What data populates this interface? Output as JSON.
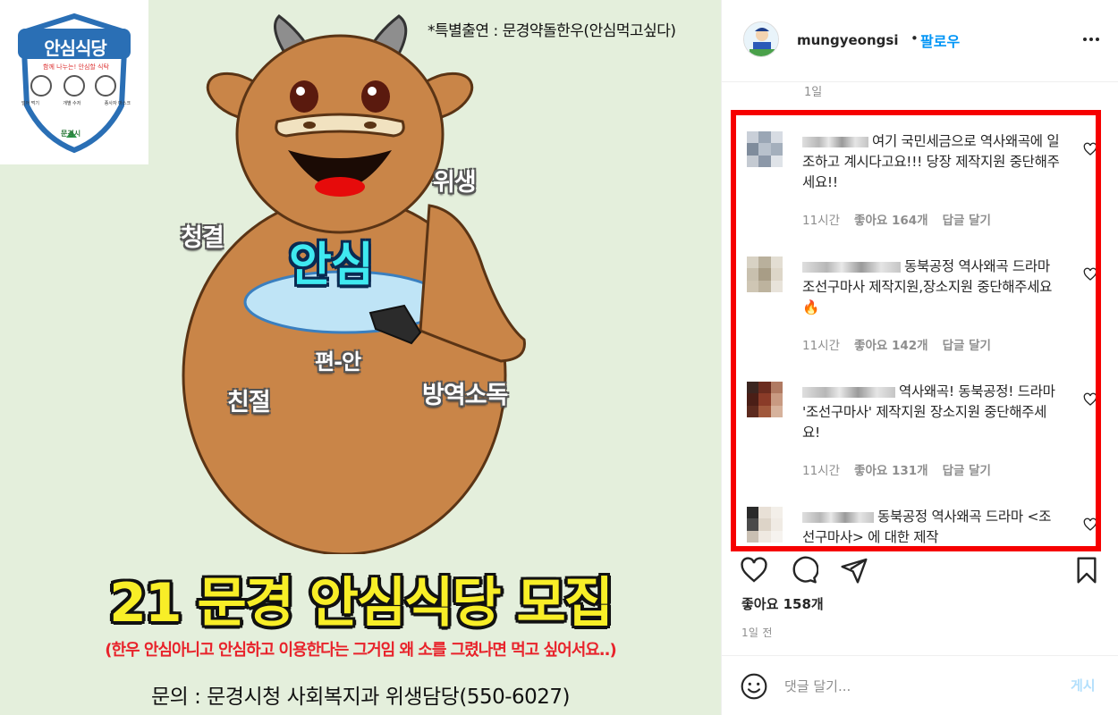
{
  "poster": {
    "logo": {
      "title": "안심식당",
      "tagline": "함께 나누는! 안심할 식탁",
      "items": [
        "덜어 먹기",
        "개별 수저",
        "종사자 마스크"
      ],
      "org": "문경시"
    },
    "special_guest": "*특별출연 : 문경약돌한우(안심먹고싶다)",
    "labels": {
      "center": "안심",
      "hygiene": "위생",
      "clean": "청결",
      "comfort": "편-안",
      "kind": "친절",
      "disinfect": "방역소독"
    },
    "headline": "21 문경 안심식당 모집",
    "subline": "(한우 안심아니고 안심하고 이용한다는 그거임 왜 소를 그렸나면 먹고 싶어서요..)",
    "contact": "문의 : 문경시청 사회복지과 위생담당(550-6027)"
  },
  "post": {
    "username": "mungyeongsi",
    "follow_dot": "•",
    "follow_label": "팔로우",
    "more_icon": "more-horizontal-icon",
    "prev_comment_time": "1일",
    "comments": [
      {
        "text": "여기 국민세금으로 역사왜곡에 일조하고 계시다고요!!! 당장 제작지원 중단해주세요!!",
        "time": "11시간",
        "likes": "좋아요 164개",
        "reply": "답글 달기",
        "avatar_colors": [
          "#c9cfd8",
          "#9aa6b5",
          "#d7dce3",
          "#7f8c9c",
          "#b8c1cc",
          "#a4afbc",
          "#c4cad2",
          "#8c98a8",
          "#dfe3e8"
        ]
      },
      {
        "text": "동북공정 역사왜곡 드라마 조선구마사 제작지원,장소지원 중단해주세요🔥",
        "time": "11시간",
        "likes": "좋아요 142개",
        "reply": "답글 달기",
        "avatar_colors": [
          "#d8d2c4",
          "#b9b09c",
          "#e3ded3",
          "#c8c0ae",
          "#a89d86",
          "#ddd6c8",
          "#cfc6b4",
          "#bdb39e",
          "#e8e3da"
        ]
      },
      {
        "text": "역사왜곡! 동북공정! 드라마 '조선구마사' 제작지원 장소지원 중단해주세요!",
        "time": "11시간",
        "likes": "좋아요 131개",
        "reply": "답글 달기",
        "avatar_colors": [
          "#3b2520",
          "#6b2c1f",
          "#b07a62",
          "#4a1e16",
          "#8a3b28",
          "#c89a82",
          "#5c2a1e",
          "#a0583c",
          "#d6b29c"
        ]
      },
      {
        "text": "동북공정 역사왜곡 드라마 <조선구마사> 에 대한 제작",
        "time": "",
        "likes": "",
        "reply": "",
        "avatar_colors": [
          "#2a2a2a",
          "#e8e0d6",
          "#f3efe9",
          "#4a4a4a",
          "#ddd4c8",
          "#f0ebe4",
          "#c9bfb2",
          "#efe9e1",
          "#f6f3ef"
        ]
      }
    ],
    "likes_total": "좋아요 158개",
    "post_time": "1일 전",
    "comment_placeholder": "댓글 달기...",
    "post_button": "게시",
    "colors": {
      "accent": "#0095f6",
      "highlight_frame": "#f60000",
      "headline_yellow": "#f8ee27",
      "subline_red": "#e8232b",
      "cow_body": "#c98548"
    }
  }
}
